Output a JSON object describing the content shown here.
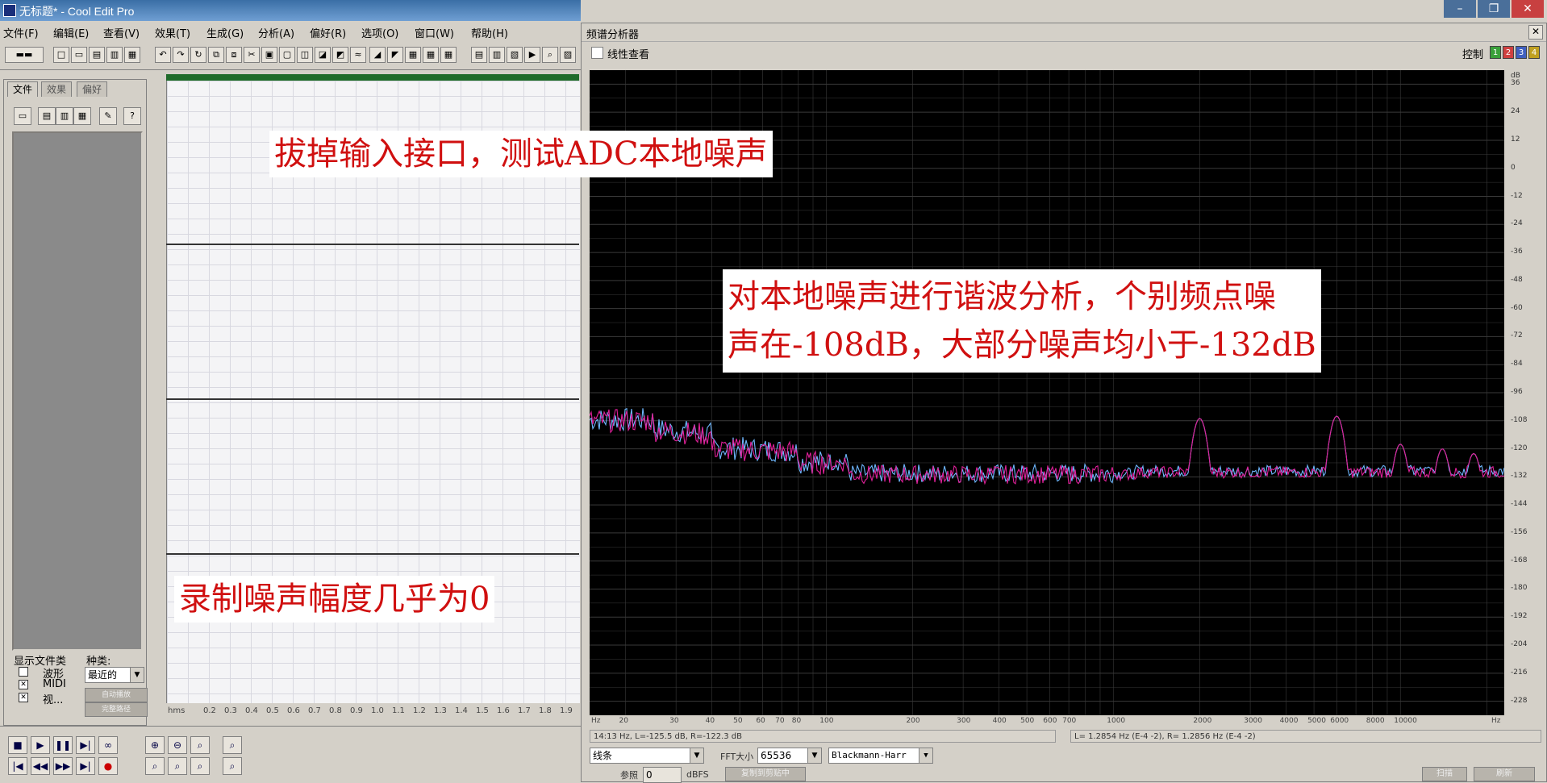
{
  "app": {
    "title": "无标题* - Cool Edit Pro",
    "menu": [
      "文件(F)",
      "编辑(E)",
      "查看(V)",
      "效果(T)",
      "生成(G)",
      "分析(A)",
      "偏好(R)",
      "选项(O)",
      "窗口(W)",
      "帮助(H)"
    ],
    "window_buttons": [
      "–",
      "❐",
      "✕"
    ]
  },
  "organizer": {
    "tabs": [
      "文件",
      "效果",
      "偏好"
    ],
    "show_types_label": "显示文件类",
    "kind_label": "种类:",
    "types": [
      "波形",
      "MIDI",
      "视..."
    ],
    "kind_value": "最近的",
    "buttons": [
      "自动播放",
      "完整路径"
    ]
  },
  "ruler": {
    "unit": "hms",
    "ticks": [
      "0.2",
      "0.3",
      "0.4",
      "0.5",
      "0.6",
      "0.7",
      "0.8",
      "0.9",
      "1.0",
      "1.1",
      "1.2",
      "1.3",
      "1.4",
      "1.5",
      "1.6",
      "1.7",
      "1.8",
      "1.9"
    ]
  },
  "spectrum": {
    "title": "频谱分析器",
    "linear_view_label": "线性查看",
    "control_label": "控制",
    "control_buttons": [
      "1",
      "2",
      "3",
      "4"
    ],
    "control_colors": [
      "#3aa03a",
      "#d04040",
      "#4060c0",
      "#c0a020"
    ],
    "y_unit": "dB",
    "y_ticks": [
      "36",
      "24",
      "12",
      "0",
      "-12",
      "-24",
      "-36",
      "-48",
      "-60",
      "-72",
      "-84",
      "-96",
      "-108",
      "-120",
      "-132",
      "-144",
      "-156",
      "-168",
      "-180",
      "-192",
      "-204",
      "-216",
      "-228"
    ],
    "x_ticks": [
      "Hz",
      "20",
      "30",
      "40",
      "50",
      "60",
      "70",
      "80",
      "100",
      "200",
      "300",
      "400",
      "500",
      "600",
      "700",
      "1000",
      "2000",
      "3000",
      "4000",
      "5000",
      "6000",
      "8000",
      "10000",
      "Hz"
    ],
    "status_left": "14:13 Hz, L=-125.5 dB, R=-122.3 dB",
    "status_right": "L= 1.2854 Hz (E-4 -2), R= 1.2856 Hz (E-4 -2)",
    "plot_type": "线条",
    "fft_label": "FFT大小",
    "fft_value": "65536",
    "window_func": "Blackmann-Harr",
    "ref_label": "参照",
    "ref_value": "0",
    "ref_unit": "dBFS",
    "copy_button": "复制到剪贴中",
    "scan_button": "扫描",
    "refresh_button": "刷新",
    "colors": {
      "left": "#e0209a",
      "right": "#6fb8ff",
      "grid": "#3a3a3a"
    }
  },
  "annotations": {
    "top": "拔掉输入接口，测试ADC本地噪声",
    "right_line1": "对本地噪声进行谐波分析，个别频点噪",
    "right_line2": "声在-108dB，大部分噪声均小于-132dB",
    "bottom": "录制噪声幅度几乎为0"
  }
}
